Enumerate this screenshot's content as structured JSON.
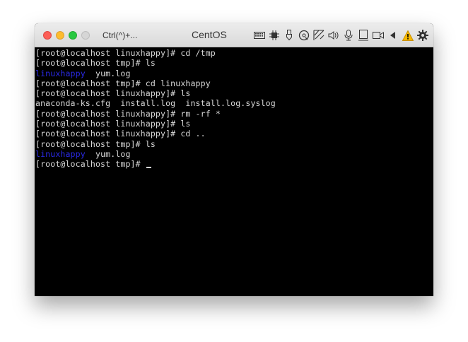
{
  "window": {
    "shortcut_label": "Ctrl(^)+...",
    "title": "CentOS",
    "toolbar_icons": [
      "keyboard-icon",
      "cpu-icon",
      "usb-icon",
      "optical-disc-icon",
      "network-icon",
      "audio-icon",
      "microphone-icon",
      "display-icon",
      "video-icon",
      "sound-icon",
      "warning-icon",
      "gear-icon"
    ],
    "colors": {
      "close": "#fc5f57",
      "minimize": "#fdbc2e",
      "zoom": "#28c840",
      "warning": "#f5b800",
      "directory": "#2a2ae6"
    }
  },
  "terminal": {
    "l1": "[root@localhost linuxhappy]# cd /tmp",
    "l2": "[root@localhost tmp]# ls",
    "l3_dir": "linuxhappy",
    "l3_file": "yum.log",
    "l4": "[root@localhost tmp]# cd linuxhappy",
    "l5": "[root@localhost linuxhappy]# ls",
    "l6": "anaconda-ks.cfg  install.log  install.log.syslog",
    "l7": "[root@localhost linuxhappy]# rm -rf *",
    "l8": "[root@localhost linuxhappy]# ls",
    "l9": "[root@localhost linuxhappy]# cd ..",
    "l10": "[root@localhost tmp]# ls",
    "l11_dir": "linuxhappy",
    "l11_file": "yum.log",
    "l12": "[root@localhost tmp]# "
  }
}
